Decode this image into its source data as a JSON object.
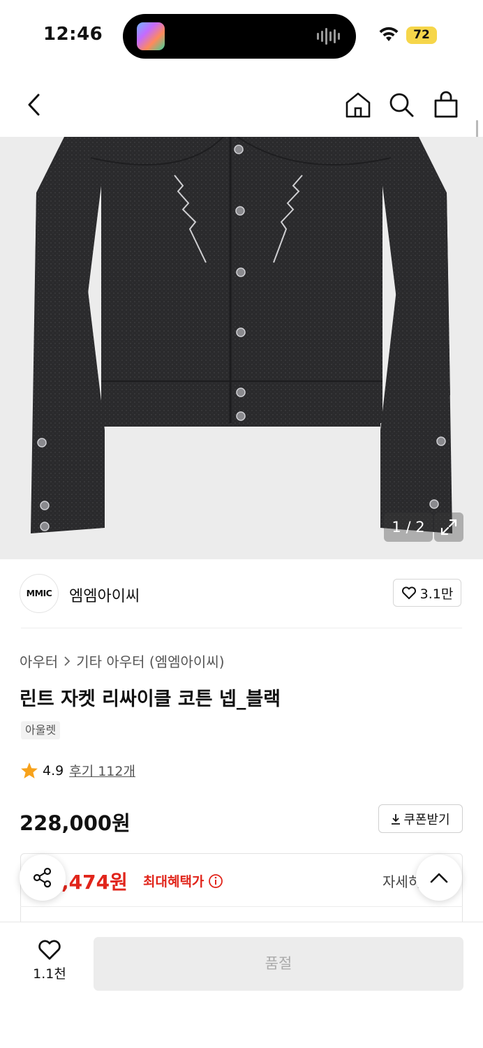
{
  "status_bar": {
    "time": "12:46",
    "battery": "72",
    "icons": [
      "wifi-icon",
      "audio-wave-icon"
    ]
  },
  "nav": {
    "icons": [
      "back-chevron-icon",
      "home-icon",
      "search-icon",
      "bag-icon"
    ]
  },
  "product_image": {
    "counter": "1 / 2",
    "alt": "black snap-button jacket"
  },
  "brand": {
    "logo": "MMIC",
    "name": "엠엠아이씨",
    "likes": "3.1만"
  },
  "breadcrumb": {
    "category": "아우터",
    "subcategory": "기타 아우터 (엠엠아이씨)"
  },
  "product": {
    "title": "린트 자켓 리싸이클 코튼 넵_블랙",
    "tag": "아울렛",
    "rating": "4.9",
    "reviews": "후기 112개",
    "price": "228,000원",
    "coupon": "쿠폰받기"
  },
  "benefit": {
    "max_price": ",474원",
    "max_label": "최대혜택가",
    "details": "자세히"
  },
  "bottom": {
    "wish_count": "1.1천",
    "buy_label": "품절"
  },
  "colors": {
    "accent_red": "#e1251b",
    "battery_yellow": "#f6d64a"
  }
}
